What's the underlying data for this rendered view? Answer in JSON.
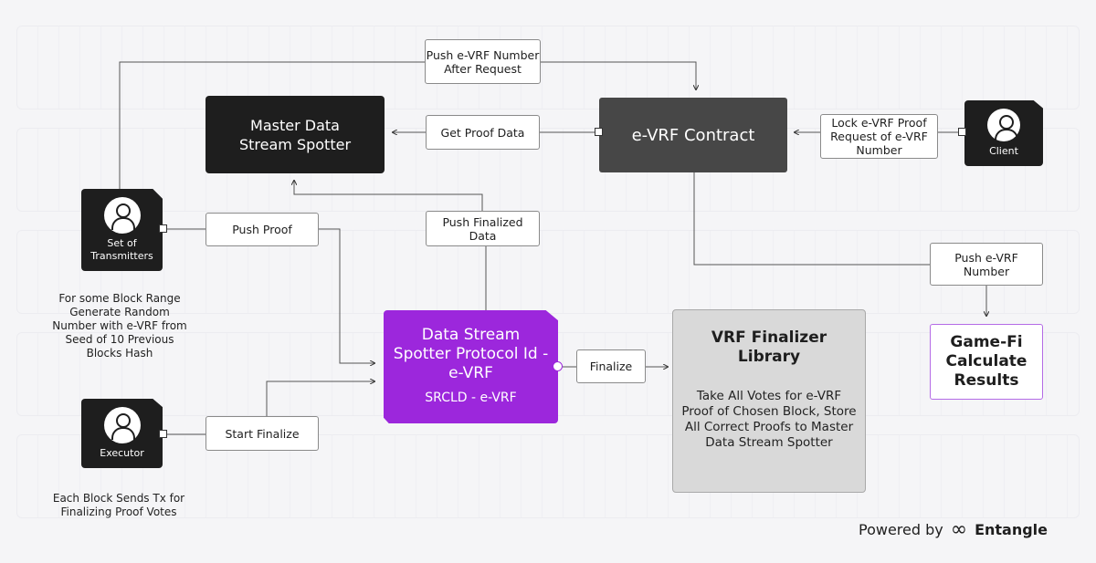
{
  "nodes": {
    "master": "Master Data Stream Spotter",
    "contract": "e-VRF Contract",
    "client": "Client",
    "transmitters": "Set of Transmitters",
    "executor": "Executor",
    "protocol": {
      "title": "Data Stream Spotter Protocol Id -e-VRF",
      "sub": "SRCLD - e-VRF"
    },
    "finalizer": {
      "title": "VRF Finalizer Library",
      "desc": "Take All Votes for e-VRF Proof of Chosen Block, Store All Correct Proofs to Master Data Stream Spotter"
    },
    "gamefi": "Game-Fi Calculate Results"
  },
  "edges": {
    "push_after_request": "Push e-VRF Number After Request",
    "get_proof": "Get Proof Data",
    "lock": "Lock e-VRF Proof Request of e-VRF Number",
    "push_proof": "Push Proof",
    "push_finalized": "Push Finalized Data",
    "push_number": "Push e-VRF Number",
    "finalize": "Finalize",
    "start_finalize": "Start Finalize"
  },
  "notes": {
    "transmitters": "For some Block Range Generate Random Number with e-VRF from Seed of 10 Previous Blocks Hash",
    "executor": "Each Block Sends Tx for Finalizing Proof Votes"
  },
  "footer": {
    "powered": "Powered by",
    "brand": "Entangle",
    "logo": "infinity-icon"
  },
  "colors": {
    "accent": "#9c27dc",
    "dark": "#1e1e1e",
    "contract": "#474747"
  }
}
